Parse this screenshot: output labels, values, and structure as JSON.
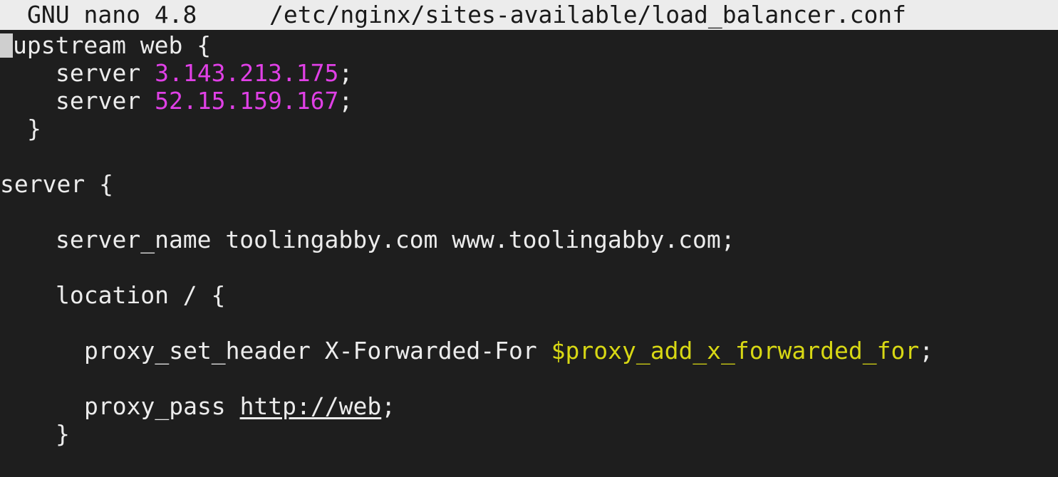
{
  "titlebar": {
    "app": "GNU nano 4.8",
    "file": "/etc/nginx/sites-available/load_balancer.conf"
  },
  "code": {
    "line1": "upstream web {",
    "line2_kw": "server",
    "line2_ip": "3.143.213.175",
    "line3_kw": "server",
    "line3_ip": "52.15.159.167",
    "line4": "}",
    "line6": "server {",
    "line8": "server_name toolingabby.com www.toolingabby.com;",
    "line10": "location / {",
    "line12_text": "proxy_set_header X-Forwarded-For",
    "line12_var": "$proxy_add_x_forwarded_for",
    "line14_text": "proxy_pass",
    "line14_url": "http://web",
    "line15": "}"
  },
  "colors": {
    "background": "#1e1e1e",
    "titlebar": "#ececec",
    "text": "#ececec",
    "number": "#e040e6",
    "variable": "#d8d814"
  }
}
